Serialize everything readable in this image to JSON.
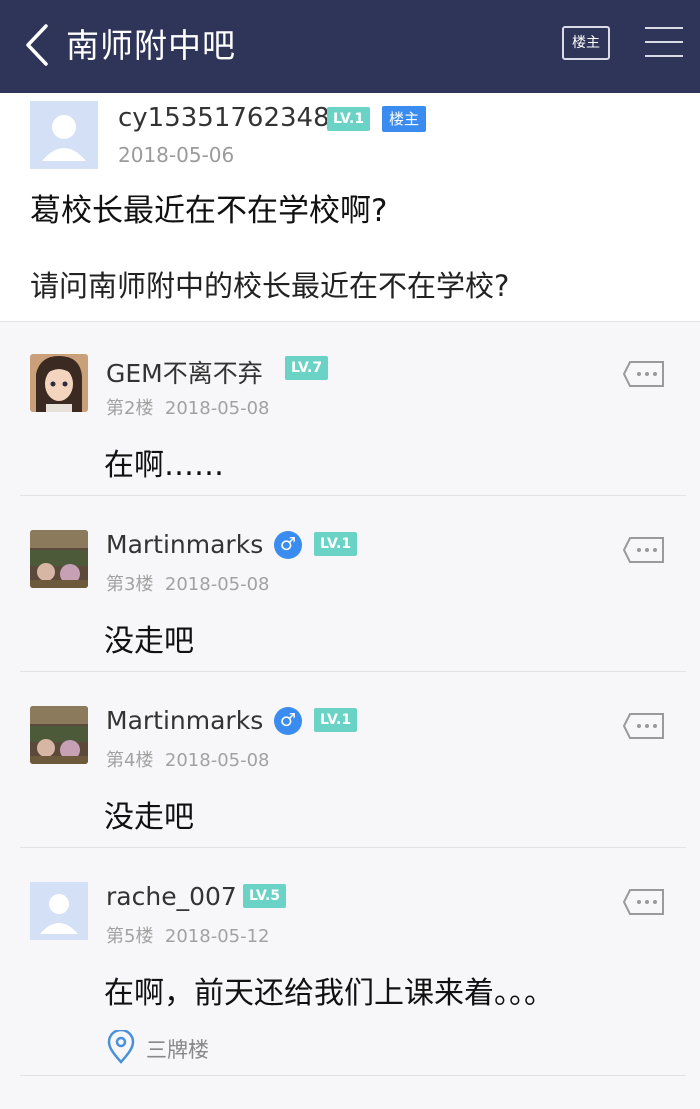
{
  "header": {
    "title": "南师附中吧",
    "owner_filter": "楼主"
  },
  "op": {
    "username": "cy15351762348",
    "level": "LV.1",
    "owner_badge": "楼主",
    "date": "2018-05-06",
    "title": "葛校长最近在不在学校啊?",
    "body": "请问南师附中的校长最近在不在学校?"
  },
  "replies": [
    {
      "username": "GEM不离不弃",
      "level": "LV.7",
      "floor": "第2楼",
      "date": "2018-05-08",
      "content": "在啊……",
      "avatar": "anime-girl-avatar"
    },
    {
      "username": "Martinmarks",
      "gender": "♂",
      "level": "LV.1",
      "floor": "第3楼",
      "date": "2018-05-08",
      "content": "没走吧",
      "avatar": "game-scene-avatar"
    },
    {
      "username": "Martinmarks",
      "gender": "♂",
      "level": "LV.1",
      "floor": "第4楼",
      "date": "2018-05-08",
      "content": "没走吧",
      "avatar": "game-scene-avatar"
    },
    {
      "username": "rache_007",
      "level": "LV.5",
      "floor": "第5楼",
      "date": "2018-05-12",
      "content": "在啊，前天还给我们上课来着。。。",
      "location": "三牌楼",
      "avatar": "default-avatar"
    }
  ],
  "colors": {
    "header_bg": "#2f3459",
    "level_badge": "#6bd2c6",
    "owner_badge": "#3b8cf0",
    "gender_male": "#3b8cf0"
  }
}
